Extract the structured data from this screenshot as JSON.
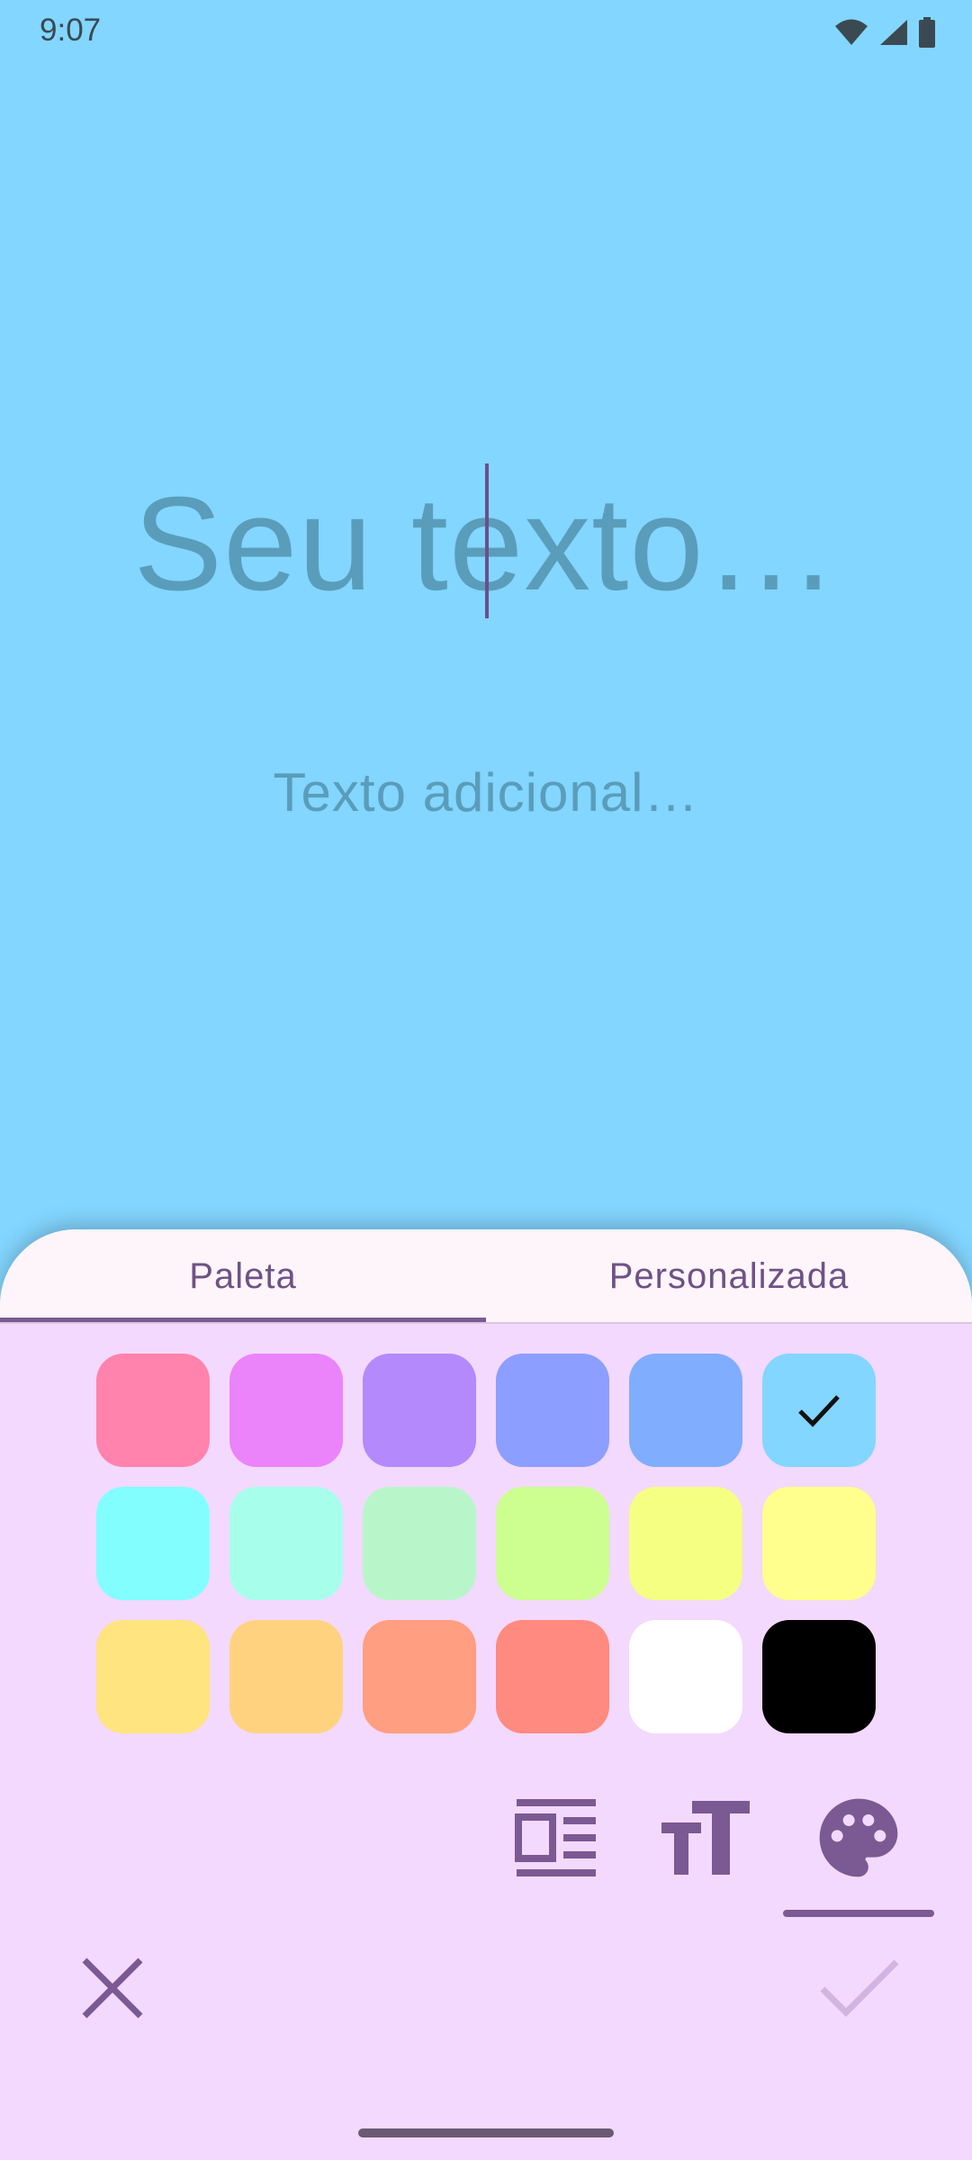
{
  "status": {
    "time": "9:07"
  },
  "editor": {
    "main_text": "Seu texto…",
    "sub_text": "Texto adicional…"
  },
  "tabs": [
    {
      "label": "Paleta",
      "selected": true
    },
    {
      "label": "Personalizada",
      "selected": false
    }
  ],
  "palette": [
    [
      "#ff83ac",
      "#eb83fb",
      "#b489fc",
      "#8c9eff",
      "#80adfe",
      "#82d6ff"
    ],
    [
      "#83feff",
      "#a7ffeb",
      "#b8f6ca",
      "#ccfe90",
      "#f5ff82",
      "#feff8c"
    ],
    [
      "#ffe47f",
      "#ffd280",
      "#ff9e80",
      "#ff8a7f",
      "#ffffff",
      "#000000"
    ]
  ],
  "selected_color": "#82d6ff",
  "toolbar": {
    "tools": [
      "layout-icon",
      "text-size-icon",
      "palette-icon"
    ],
    "active_tool": "palette-icon"
  },
  "colors": {
    "background": "#82d6ff",
    "sheet": "#f3d9fd",
    "accent": "#7b5993"
  }
}
